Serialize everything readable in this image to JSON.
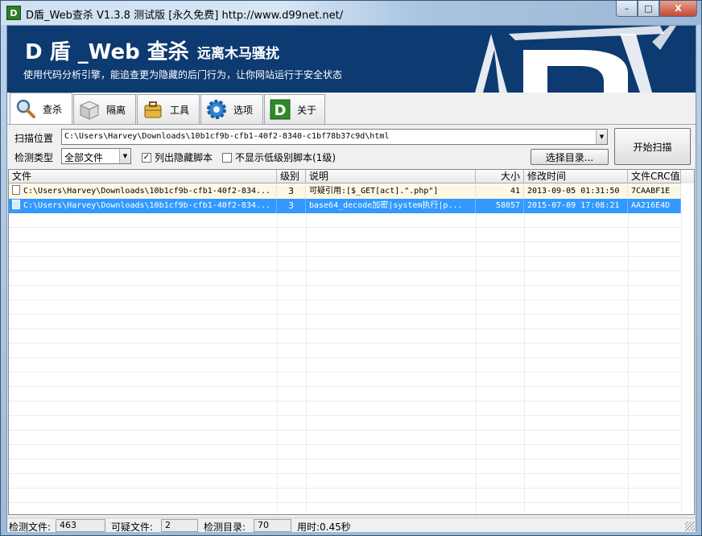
{
  "window": {
    "title": "D盾_Web查杀 V1.3.8 测试版 [永久免费] http://www.d99net.net/",
    "icon_text": "D",
    "min_glyph": "–",
    "max_glyph": "□",
    "close_glyph": "X"
  },
  "banner": {
    "title": "D 盾 _Web 查杀",
    "subtitle": "远离木马骚扰",
    "slogan": "使用代码分析引擎，能追查更为隐藏的后门行为，让你网站运行于安全状态"
  },
  "tabs": [
    {
      "label": "查杀",
      "icon": "magnifier-icon",
      "active": true
    },
    {
      "label": "隔离",
      "icon": "box-icon",
      "active": false
    },
    {
      "label": "工具",
      "icon": "briefcase-icon",
      "active": false
    },
    {
      "label": "选项",
      "icon": "gear-icon",
      "active": false
    },
    {
      "label": "关于",
      "icon": "d-logo-icon",
      "active": false
    }
  ],
  "scan": {
    "path_label": "扫描位置",
    "path_value": "C:\\Users\\Harvey\\Downloads\\10b1cf9b-cfb1-40f2-8340-c1bf78b37c9d\\html",
    "type_label": "检测类型",
    "type_value": "全部文件",
    "show_hidden_label": "列出隐藏脚本",
    "show_hidden_checked": true,
    "hide_low_label": "不显示低级别脚本(1级)",
    "hide_low_checked": false,
    "choose_dir_button": "选择目录...",
    "start_scan_button": "开始扫描"
  },
  "grid": {
    "columns": [
      "文件",
      "级别",
      "说明",
      "大小",
      "修改时间",
      "文件CRC值"
    ],
    "rows": [
      {
        "file": "C:\\Users\\Harvey\\Downloads\\10b1cf9b-cfb1-40f2-834...",
        "level": "3",
        "desc": "可疑引用:[$_GET[act].\".php\"]",
        "size": "41",
        "mtime": "2013-09-05 01:31:50",
        "crc": "7CAABF1E"
      },
      {
        "file": "C:\\Users\\Harvey\\Downloads\\10b1cf9b-cfb1-40f2-834...",
        "level": "3",
        "desc": "base64_decode加密|system执行|p...",
        "size": "58057",
        "mtime": "2015-07-09 17:08:21",
        "crc": "AA216E4D"
      }
    ]
  },
  "status": {
    "files_label": "检测文件:",
    "files_value": "463",
    "suspicious_label": "可疑文件:",
    "suspicious_value": "2",
    "dirs_label": "检测目录:",
    "dirs_value": "70",
    "time_label": "用时:0.45秒"
  },
  "colors": {
    "banner_bg": "#0d3a70",
    "selection": "#3399ff",
    "row_highlight": "#fdf8e4"
  }
}
